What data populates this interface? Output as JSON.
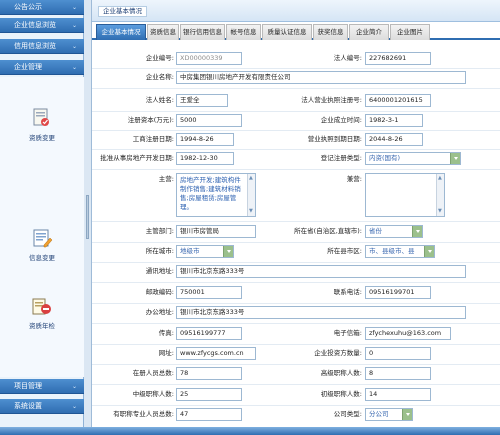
{
  "sidebar": {
    "top_items": [
      {
        "label": "公告公示"
      },
      {
        "label": "企业信息浏览"
      },
      {
        "label": "信用信息浏览"
      },
      {
        "label": "企业管理"
      }
    ],
    "entries": [
      {
        "label": "资质变更",
        "icon": "certificate-edit-icon"
      },
      {
        "label": "信息变更",
        "icon": "document-edit-icon"
      },
      {
        "label": "资质年检",
        "icon": "annual-inspection-icon"
      }
    ],
    "bottom_items": [
      {
        "label": "项目管理"
      },
      {
        "label": "系统设置"
      }
    ]
  },
  "header": {
    "title": "企业基本情况"
  },
  "tabs": [
    {
      "label": "企业基本情况",
      "active": true
    },
    {
      "label": "资质信息"
    },
    {
      "label": "银行信用信息"
    },
    {
      "label": "帐号信息"
    },
    {
      "label": "质量认证信息"
    },
    {
      "label": "获奖信息"
    },
    {
      "label": "企业简介"
    },
    {
      "label": "企业图片"
    }
  ],
  "form": {
    "company_no_label": "企业编号:",
    "company_no_value": "XD00000339",
    "legal_no_label": "法人编号:",
    "legal_no_value": "227682691",
    "company_name_label": "企业名称:",
    "company_name_value": "中房集团银川房地产开发有限责任公司",
    "legal_name_label": "法人姓名:",
    "legal_name_value": "王爱全",
    "license_label": "法人营业执照注册号:",
    "license_value": "6400001201615",
    "capital_label": "注册资本(万元):",
    "capital_value": "5000",
    "founded_label": "企业成立时间:",
    "founded_value": "1982-3-1",
    "reg_date_label": "工商注册日期:",
    "reg_date_value": "1994-8-26",
    "license_expire_label": "营业执照到期日期:",
    "license_expire_value": "2044-8-26",
    "approval_date_label": "批准从事房地产开发日期:",
    "approval_date_value": "1982-12-30",
    "reg_type_label": "登记注册类型:",
    "reg_type_value": "内资(国有)",
    "main_business_label": "主营:",
    "main_business_value": "房地产开发;建筑构件制作销售;建筑材料销售;房屋租赁;房屋管理。",
    "side_business_label": "兼营:",
    "authority_label": "主管部门:",
    "authority_value": "银川市房管局",
    "province_label": "所在省(自治区,直辖市):",
    "province_value": "省份",
    "city_label": "所在城市:",
    "city_value": "地级市",
    "county_label": "所在县市区:",
    "county_value": "市、县级市、县",
    "address_label": "通讯地址:",
    "address_value": "银川市北京东路333号",
    "postcode_label": "邮政编码:",
    "postcode_value": "750001",
    "phone_label": "联系电话:",
    "phone_value": "09516199701",
    "office_label": "办公地址:",
    "office_value": "银川市北京东路333号",
    "fax_label": "传真:",
    "fax_value": "09516199777",
    "email_label": "电子信箱:",
    "email_value": "zfychexuhu@163.com",
    "website_label": "网址:",
    "website_value": "www.zfycgs.com.cn",
    "investment_label": "企业投资方数量:",
    "investment_value": "0",
    "staff_label": "在册人员总数:",
    "staff_value": "78",
    "senior_label": "高级职称人数:",
    "senior_value": "8",
    "mid_label": "中级职称人数:",
    "mid_value": "25",
    "junior_label": "初级职称人数:",
    "junior_value": "14",
    "pro_label": "有职称专业人员总数:",
    "pro_value": "47",
    "company_type_label": "公司类型:",
    "company_type_value": "分公司"
  }
}
